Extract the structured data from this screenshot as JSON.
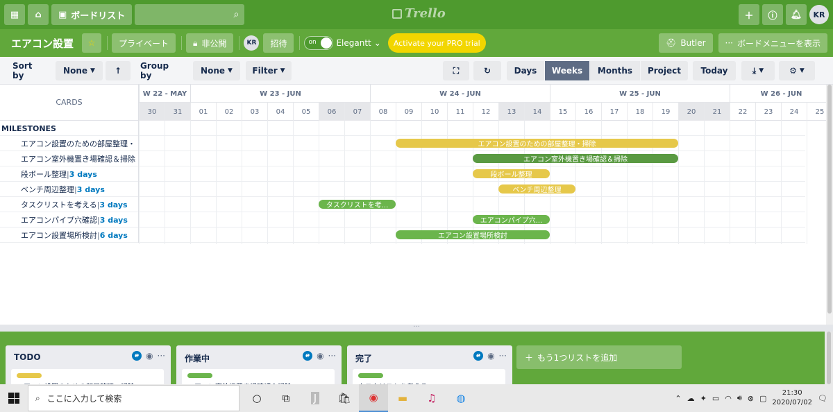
{
  "topbar": {
    "board_list_label": "ボードリスト",
    "logo_text": "Trello",
    "user_initials": "KR"
  },
  "board": {
    "title": "エアコン設置",
    "privacy_label": "プライベート",
    "visibility_label": "非公開",
    "member_initials": "KR",
    "invite_label": "招待",
    "toggle_label": "on",
    "powerup_label": "Elegantt",
    "pro_trial_label": "Activate your PRO trial",
    "butler_label": "Butler",
    "menu_label": "ボードメニューを表示"
  },
  "toolbar": {
    "sort_by_label": "Sort by",
    "sort_value": "None",
    "group_by_label": "Group by",
    "group_value": "None",
    "filter_label": "Filter",
    "view_days": "Days",
    "view_weeks": "Weeks",
    "view_months": "Months",
    "view_project": "Project",
    "today_label": "Today",
    "active_view": "Weeks"
  },
  "gantt": {
    "cards_header": "CARDS",
    "milestones_label": "MILESTONES",
    "weeks": [
      {
        "label": "W 22 - MAY",
        "span": 2
      },
      {
        "label": "W 23 - JUN",
        "span": 7
      },
      {
        "label": "W 24 - JUN",
        "span": 7
      },
      {
        "label": "W 25 - JUN",
        "span": 7
      },
      {
        "label": "W 26 - JUN",
        "span": 4
      }
    ],
    "days": [
      {
        "d": "30",
        "weekend": true
      },
      {
        "d": "31",
        "weekend": true
      },
      {
        "d": "01",
        "weekend": false
      },
      {
        "d": "02",
        "weekend": false
      },
      {
        "d": "03",
        "weekend": false
      },
      {
        "d": "04",
        "weekend": false
      },
      {
        "d": "05",
        "weekend": false
      },
      {
        "d": "06",
        "weekend": true
      },
      {
        "d": "07",
        "weekend": true
      },
      {
        "d": "08",
        "weekend": false
      },
      {
        "d": "09",
        "weekend": false
      },
      {
        "d": "10",
        "weekend": false
      },
      {
        "d": "11",
        "weekend": false
      },
      {
        "d": "12",
        "weekend": false
      },
      {
        "d": "13",
        "weekend": true
      },
      {
        "d": "14",
        "weekend": true
      },
      {
        "d": "15",
        "weekend": false
      },
      {
        "d": "16",
        "weekend": false
      },
      {
        "d": "17",
        "weekend": false
      },
      {
        "d": "18",
        "weekend": false
      },
      {
        "d": "19",
        "weekend": false
      },
      {
        "d": "20",
        "weekend": true
      },
      {
        "d": "21",
        "weekend": true
      },
      {
        "d": "22",
        "weekend": false
      },
      {
        "d": "23",
        "weekend": false
      },
      {
        "d": "24",
        "weekend": false
      },
      {
        "d": "25",
        "weekend": false
      }
    ],
    "tasks": [
      {
        "name": "エアコン設置のための部屋整理・",
        "duration": "",
        "bar_label": "エアコン設置のための部屋整理・掃除",
        "start": "09",
        "end": "19",
        "color": "yellow"
      },
      {
        "name": "エアコン室外機置き場確認＆掃除",
        "duration": "",
        "bar_label": "エアコン室外機置き場確認＆掃除",
        "start": "12",
        "end": "19",
        "color": "darkgreen"
      },
      {
        "name": "段ボール整理",
        "duration": "3 days",
        "bar_label": "段ボール整理",
        "start": "12",
        "end": "14",
        "color": "yellow"
      },
      {
        "name": "ベンチ周辺整理",
        "duration": "3 days",
        "bar_label": "ベンチ周辺整理",
        "start": "13",
        "end": "15",
        "color": "yellow"
      },
      {
        "name": "タスクリストを考える",
        "duration": "3 days",
        "bar_label": "タスクリストを考...",
        "start": "06",
        "end": "08",
        "color": "green"
      },
      {
        "name": "エアコンパイプ穴確認",
        "duration": "3 days",
        "bar_label": "エアコンパイプ穴...",
        "start": "12",
        "end": "14",
        "color": "green"
      },
      {
        "name": "エアコン設置場所検討",
        "duration": "6 days",
        "bar_label": "エアコン設置場所検討",
        "start": "09",
        "end": "14",
        "color": "green"
      }
    ]
  },
  "lists": [
    {
      "title": "TODO",
      "label_color": "#e6c84a",
      "card_text": "エアコン設置のための部屋整理・掃除"
    },
    {
      "title": "作業中",
      "label_color": "#6bb54c",
      "card_text": "エアコン室外機置き場確認＆掃除"
    },
    {
      "title": "完了",
      "label_color": "#6bb54c",
      "card_text": "タスクリストを考える"
    }
  ],
  "add_list_label": "もう1つリストを追加",
  "taskbar": {
    "search_placeholder": "ここに入力して検索",
    "time": "21:30",
    "date": "2020/07/02"
  },
  "colors": {
    "topbar": "#4e9a2e",
    "boardbar": "#61a83b",
    "bar_yellow": "#e6c84a",
    "bar_green": "#6bb54c",
    "link_blue": "#0079bf"
  }
}
